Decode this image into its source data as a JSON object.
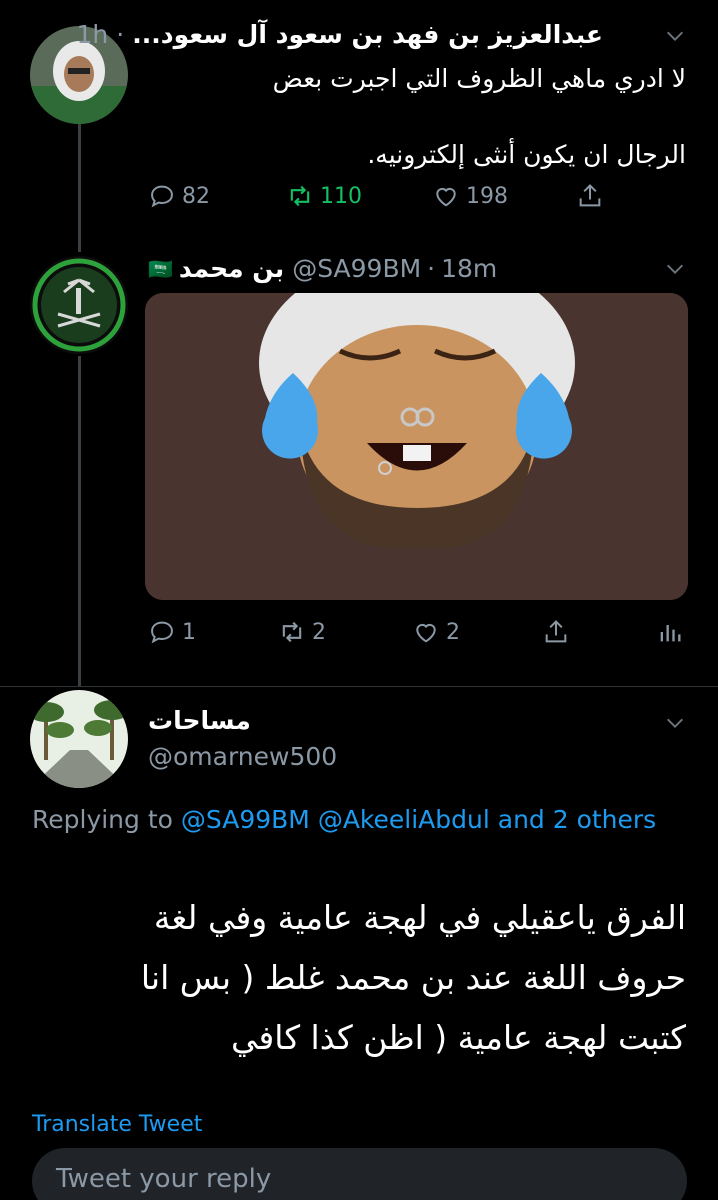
{
  "tweet1": {
    "name": "عبدالعزيز بن فهد بن سعود آل سعود...",
    "time": "1h",
    "text_line1": "لا ادري ماهي الظروف التي اجبرت بعض",
    "text_line2": "الرجال ان يكون أنثى إلكترونيه.",
    "replies": "82",
    "retweets": "110",
    "likes": "198"
  },
  "tweet2": {
    "name": "بن محمد",
    "flag": "🇸🇦",
    "handle": "@SA99BM",
    "time": "18m",
    "replies": "1",
    "retweets": "2",
    "likes": "2"
  },
  "tweet3": {
    "name": "مساحات",
    "handle": "@omarnew500",
    "replying_prefix": "Replying to",
    "replying_to": "@SA99BM @AkeeliAbdul",
    "replying_suffix_link": "and 2 others",
    "line1": "الفرق ياعقيلي في لهجة عامية وفي لغة",
    "line2": "حروف اللغة عند بن محمد غلط ( بس انا",
    "line3": "كتبت لهجة عامية ( اظن كذا كافي",
    "translate": "Translate Tweet"
  },
  "reply_box": {
    "placeholder": "Tweet your reply"
  },
  "colors": {
    "accent": "#1d9bf0",
    "retweet_active": "#17bf63",
    "muted": "#8b98a5",
    "background": "#000000"
  }
}
